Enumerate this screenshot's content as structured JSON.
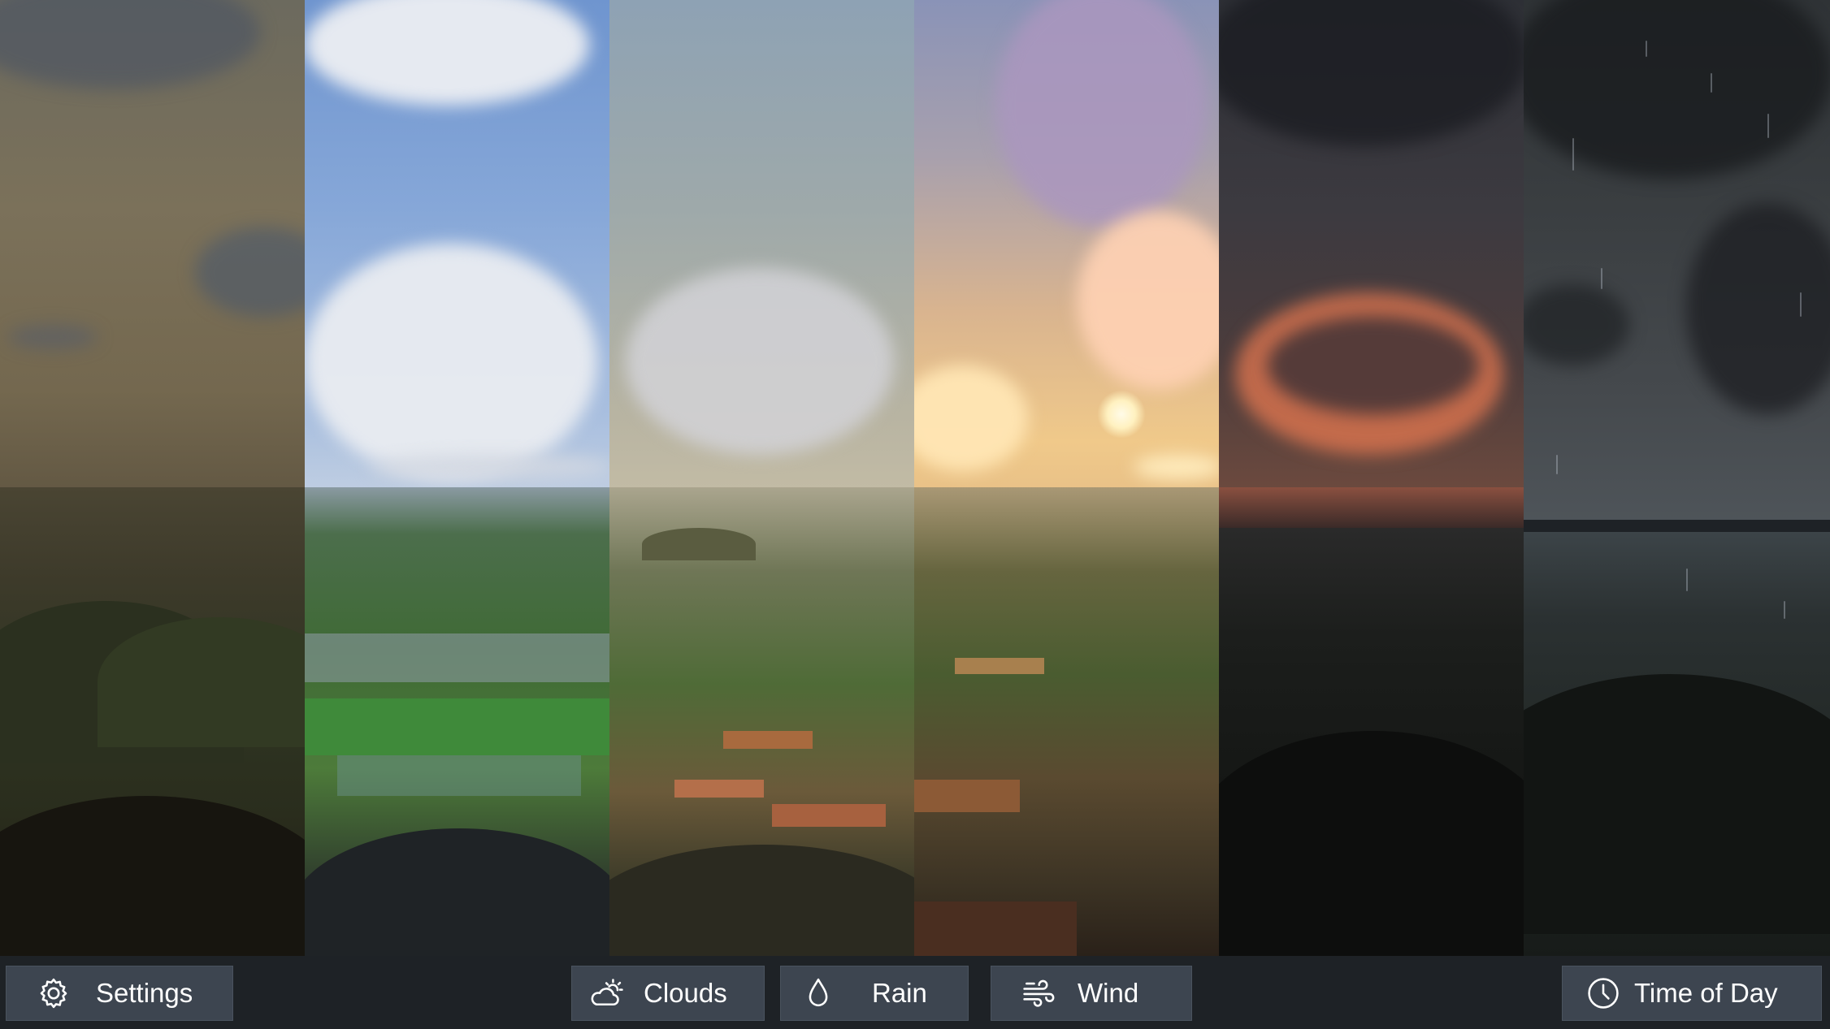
{
  "viewport": {
    "description_strips": [
      "hazy",
      "clear",
      "pale-haze",
      "sunset",
      "dusk",
      "night-rain"
    ]
  },
  "toolbar": {
    "settings": {
      "label": "Settings",
      "icon": "gear-icon"
    },
    "clouds": {
      "label": "Clouds",
      "icon": "cloud-sun-icon"
    },
    "rain": {
      "label": "Rain",
      "icon": "droplet-icon"
    },
    "wind": {
      "label": "Wind",
      "icon": "wind-icon"
    },
    "time_of_day": {
      "label": "Time of Day",
      "icon": "clock-icon"
    }
  },
  "colors": {
    "toolbar_bg": "#1e2226",
    "button_bg": "#3d4550",
    "button_text": "#ffffff"
  }
}
